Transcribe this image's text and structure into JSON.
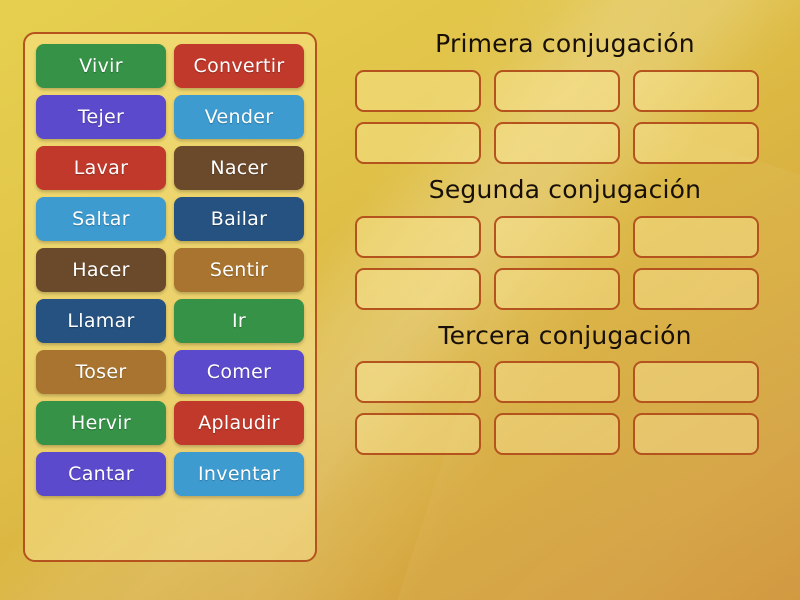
{
  "activity": {
    "type": "group-sort",
    "language": "es"
  },
  "word_bank": {
    "name": "word-bank",
    "cards": [
      {
        "label": "Vivir",
        "color": "#359247"
      },
      {
        "label": "Convertir",
        "color": "#c0392b"
      },
      {
        "label": "Tejer",
        "color": "#5b4acb"
      },
      {
        "label": "Vender",
        "color": "#3d9bd0"
      },
      {
        "label": "Lavar",
        "color": "#c0392b"
      },
      {
        "label": "Nacer",
        "color": "#6b4a2c"
      },
      {
        "label": "Saltar",
        "color": "#3d9bd0"
      },
      {
        "label": "Bailar",
        "color": "#255280"
      },
      {
        "label": "Hacer",
        "color": "#6b4a2c"
      },
      {
        "label": "Sentir",
        "color": "#a8742f"
      },
      {
        "label": "Llamar",
        "color": "#255280"
      },
      {
        "label": "Ir",
        "color": "#359247"
      },
      {
        "label": "Toser",
        "color": "#a8742f"
      },
      {
        "label": "Comer",
        "color": "#5b4acb"
      },
      {
        "label": "Hervir",
        "color": "#359247"
      },
      {
        "label": "Aplaudir",
        "color": "#c0392b"
      },
      {
        "label": "Cantar",
        "color": "#5b4acb"
      },
      {
        "label": "Inventar",
        "color": "#3d9bd0"
      }
    ]
  },
  "categories": [
    {
      "title": "Primera conjugación",
      "slots": 6,
      "filled": []
    },
    {
      "title": "Segunda conjugación",
      "slots": 6,
      "filled": []
    },
    {
      "title": "Tercera conjugación",
      "slots": 6,
      "filled": []
    }
  ],
  "theme": {
    "background_top_left": "#e6cf4f",
    "background_bottom_right": "#d09437",
    "panel_border": "#b5531f",
    "panel_fill": "rgba(255, 236, 160, 0.42)",
    "slot_border": "#b5531f",
    "slot_fill": "rgba(255, 237, 163, 0.40)",
    "title_color": "#181008",
    "card_text_color": "#ffffff"
  }
}
